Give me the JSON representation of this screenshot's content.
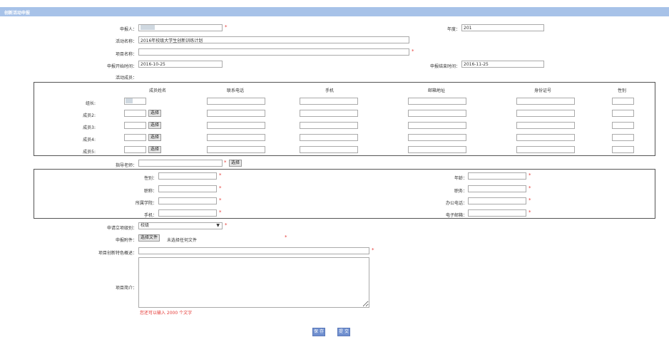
{
  "panel_title": "创新活动申报",
  "applicant": {
    "label": "申报人：",
    "value": "",
    "required": "*"
  },
  "year": {
    "label": "年度：",
    "value": "201"
  },
  "activity_name": {
    "label": "活动名称：",
    "value": "2016年校级大学生创新训练计划"
  },
  "project_name": {
    "label": "项目名称：",
    "value": "",
    "required": "*"
  },
  "start_time": {
    "label": "申报开始时间：",
    "value": "2016-10-25"
  },
  "end_time": {
    "label": "申报结束时间：",
    "value": "2016-11-25"
  },
  "members_label": "活动成员：",
  "members_table": {
    "headers": [
      "成员姓名",
      "联系电话",
      "手机",
      "邮箱地址",
      "身份证号",
      "性别"
    ],
    "rows": [
      {
        "label": "组长:"
      },
      {
        "label": "成员2:",
        "select": "选择"
      },
      {
        "label": "成员3:",
        "select": "选择"
      },
      {
        "label": "成员4:",
        "select": "选择"
      },
      {
        "label": "成员5:",
        "select": "选择"
      }
    ]
  },
  "advisor": {
    "label": "指导老师：",
    "required": "*",
    "select": "选择"
  },
  "advisor_info": {
    "gender": "性别：",
    "age": "年龄：",
    "title": "职称：",
    "post": "职务：",
    "college": "所属学院：",
    "office_phone": "办公电话：",
    "mobile": "手机：",
    "email": "电子邮箱：",
    "required": "*"
  },
  "level": {
    "label": "申请立项级别：",
    "value": "校级",
    "required": "*"
  },
  "attachment": {
    "label": "申报附件：",
    "button": "选择文件",
    "status": "未选择任何文件",
    "required": "*"
  },
  "innovation": {
    "label": "项目创新特色概述：",
    "required": "*"
  },
  "intro": {
    "label": "项目简介：",
    "hint": "您还可以输入 2000 个文字"
  },
  "actions": {
    "save": "保 存",
    "submit": "提 交"
  },
  "colors": {
    "titlebar": "#a7c2e8",
    "required": "#e53935",
    "button": "#6f8fcf"
  }
}
